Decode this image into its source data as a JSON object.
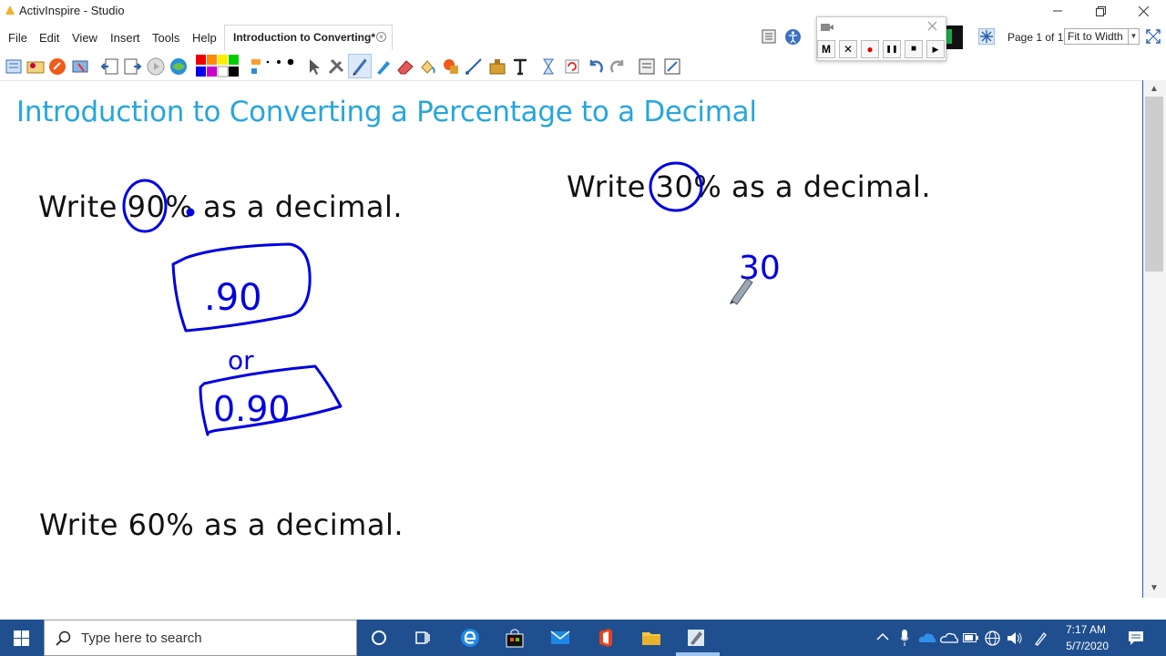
{
  "window": {
    "title": "ActivInspire - Studio"
  },
  "menu": [
    "File",
    "Edit",
    "View",
    "Insert",
    "Tools",
    "Help"
  ],
  "document_tab": {
    "label": "Introduction to Converting*"
  },
  "page_indicator": "Page 1 of 1",
  "zoom": {
    "selected": "Fit to Width"
  },
  "recorder": {
    "buttons": [
      "M",
      "✕",
      "●",
      "❚❚",
      "■",
      "▶"
    ]
  },
  "slide": {
    "title": "Introduction to Converting a Percentage to a Decimal",
    "problems": [
      {
        "pre": "Write ",
        "num": "90",
        "post": "% as a decimal."
      },
      {
        "pre": "Write ",
        "num": "30",
        "post": "% as a decimal."
      },
      {
        "pre": "Write ",
        "num": "60",
        "post": "% as a decimal."
      }
    ],
    "ink": {
      "answer1": ".90",
      "or_word": "or",
      "answer2": "0.90",
      "work2": "30",
      "pen_color": "#0000e0"
    }
  },
  "taskbar": {
    "search_placeholder": "Type here to search",
    "time": "7:17 AM",
    "date": "5/7/2020"
  },
  "colors": {
    "title_blue": "#27a6dc",
    "taskbar": "#1f4f8f"
  }
}
